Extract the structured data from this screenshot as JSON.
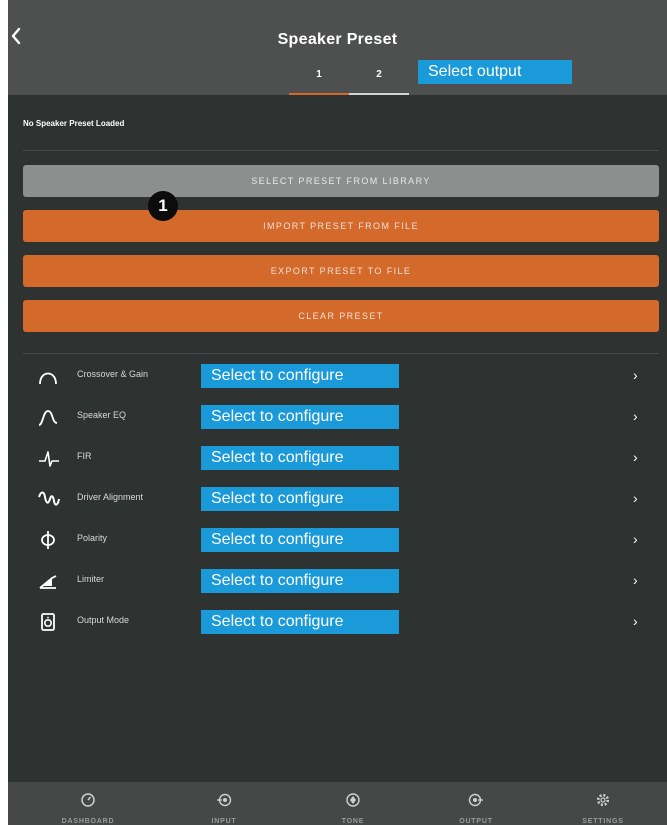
{
  "header": {
    "title": "Speaker Preset",
    "tabs": [
      {
        "label": "1",
        "active": true
      },
      {
        "label": "2",
        "active": false
      }
    ],
    "output_tag": "Select output"
  },
  "preset_status": "No Speaker Preset Loaded",
  "actions": {
    "select_library": "SELECT PRESET FROM LIBRARY",
    "import_file": "IMPORT PRESET FROM FILE",
    "export_file": "EXPORT PRESET TO FILE",
    "clear": "CLEAR PRESET"
  },
  "step_badge": "1",
  "menu": [
    {
      "label": "Crossover & Gain",
      "icon": "crossover-curve-icon",
      "tag": "Select to configure"
    },
    {
      "label": "Speaker EQ",
      "icon": "eq-curve-icon",
      "tag": "Select to configure"
    },
    {
      "label": "FIR",
      "icon": "fir-pulse-icon",
      "tag": "Select to configure"
    },
    {
      "label": "Driver Alignment",
      "icon": "wave-alignment-icon",
      "tag": "Select to configure"
    },
    {
      "label": "Polarity",
      "icon": "polarity-phi-icon",
      "tag": "Select to configure"
    },
    {
      "label": "Limiter",
      "icon": "limiter-ramp-icon",
      "tag": "Select to configure"
    },
    {
      "label": "Output Mode",
      "icon": "speaker-box-icon",
      "tag": "Select to configure"
    }
  ],
  "bottom_nav": [
    {
      "label": "DASHBOARD",
      "icon": "gauge-icon"
    },
    {
      "label": "INPUT",
      "icon": "input-target-icon"
    },
    {
      "label": "TONE",
      "icon": "tone-diamond-icon"
    },
    {
      "label": "OUTPUT",
      "icon": "output-target-icon"
    },
    {
      "label": "SETTINGS",
      "icon": "gear-icon"
    }
  ],
  "colors": {
    "background": "#2e3231",
    "header": "#4e504f",
    "accent_orange": "#d36a2c",
    "button_grey": "#8d8e8e",
    "callout_blue": "#1a9ad9"
  }
}
